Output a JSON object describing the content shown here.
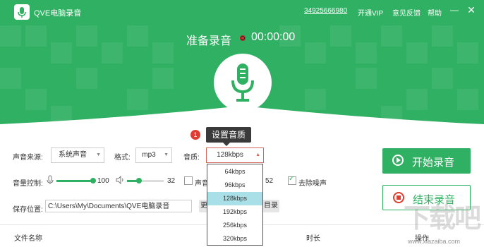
{
  "titlebar": {
    "app_title": "QVE电脑录音",
    "phone": "34925666980",
    "vip": "开通VIP",
    "feedback": "意见反馈",
    "help": "帮助",
    "minimize_glyph": "—",
    "close_glyph": "✕"
  },
  "recording": {
    "status": "准备录音",
    "timer": "00:00:00"
  },
  "tooltip": {
    "step": "1",
    "text": "设置音质"
  },
  "settings": {
    "source_label": "声音来源:",
    "source_value": "系统声音",
    "format_label": "格式:",
    "format_value": "mp3",
    "quality_label": "音质:",
    "quality_value": "128kbps",
    "volume_label": "音量控制:",
    "mic_volume": "100",
    "mic_volume_fraction": 1.0,
    "speaker_volume": "32",
    "speaker_volume_fraction": 0.32,
    "check_voice_label": "声音",
    "partial_value": "52",
    "denoise_label": "去除噪声",
    "denoise_checked": true,
    "save_label": "保存位置:",
    "save_path": "C:\\Users\\My\\Documents\\QVE电脑录音",
    "change_btn": "更",
    "open_dir_btn": "目录"
  },
  "dropdown": {
    "options": [
      "64kbps",
      "96kbps",
      "128kbps",
      "192kbps",
      "256kbps",
      "320kbps"
    ],
    "selected": "128kbps"
  },
  "actions": {
    "start": "开始录音",
    "stop": "结束录音"
  },
  "table": {
    "col_filename": "文件名称",
    "col_duration": "时长",
    "col_action": "操作"
  },
  "watermark": {
    "text": "下载吧",
    "url": "www.xiazaiba.com"
  },
  "colors": {
    "brand_green": "#30b062",
    "badge_red": "#e03c31"
  }
}
